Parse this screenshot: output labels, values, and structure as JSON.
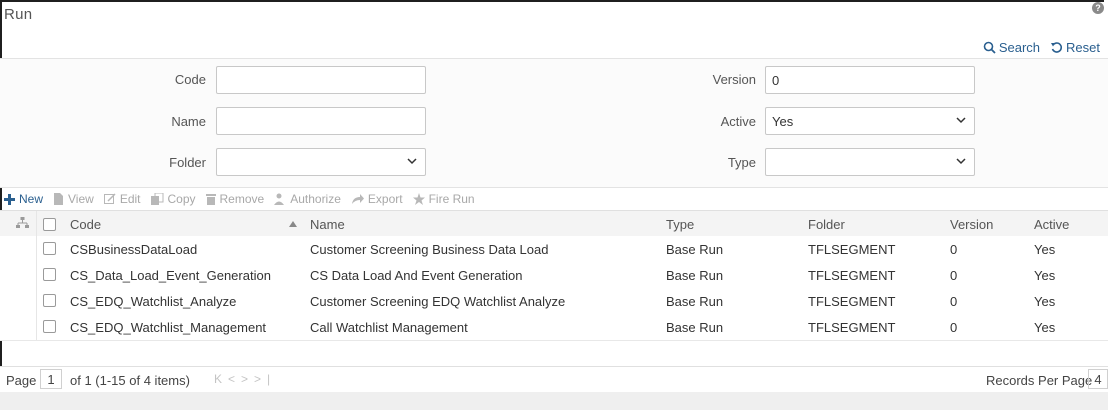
{
  "header": {
    "title": "Run",
    "help_icon": "question-circle-icon"
  },
  "actions": {
    "search": "Search",
    "reset": "Reset"
  },
  "filters": {
    "code": {
      "label": "Code",
      "value": ""
    },
    "name": {
      "label": "Name",
      "value": ""
    },
    "folder": {
      "label": "Folder",
      "value": ""
    },
    "version": {
      "label": "Version",
      "value": "0"
    },
    "active": {
      "label": "Active",
      "value": "Yes"
    },
    "type": {
      "label": "Type",
      "value": ""
    }
  },
  "toolbar": {
    "new": "New",
    "view": "View",
    "edit": "Edit",
    "copy": "Copy",
    "remove": "Remove",
    "authorize": "Authorize",
    "export": "Export",
    "fire_run": "Fire Run"
  },
  "table": {
    "columns": [
      "Code",
      "Name",
      "Type",
      "Folder",
      "Version",
      "Active"
    ],
    "rows": [
      [
        "CSBusinessDataLoad",
        "Customer Screening Business Data Load",
        "Base Run",
        "TFLSEGMENT",
        "0",
        "Yes"
      ],
      [
        "CS_Data_Load_Event_Generation",
        "CS Data Load And Event Generation",
        "Base Run",
        "TFLSEGMENT",
        "0",
        "Yes"
      ],
      [
        "CS_EDQ_Watchlist_Analyze",
        "Customer Screening EDQ Watchlist Analyze",
        "Base Run",
        "TFLSEGMENT",
        "0",
        "Yes"
      ],
      [
        "CS_EDQ_Watchlist_Management",
        "Call Watchlist Management",
        "Base Run",
        "TFLSEGMENT",
        "0",
        "Yes"
      ]
    ]
  },
  "pager": {
    "page_label": "Page",
    "page": "1",
    "summary": "of 1 (1-15 of 4 items)",
    "records_label": "Records Per Page",
    "records_value": "4"
  },
  "colors": {
    "link": "#2a5f8f",
    "disabled": "#a8a8a8",
    "new_icon": "#2a5f8f"
  }
}
